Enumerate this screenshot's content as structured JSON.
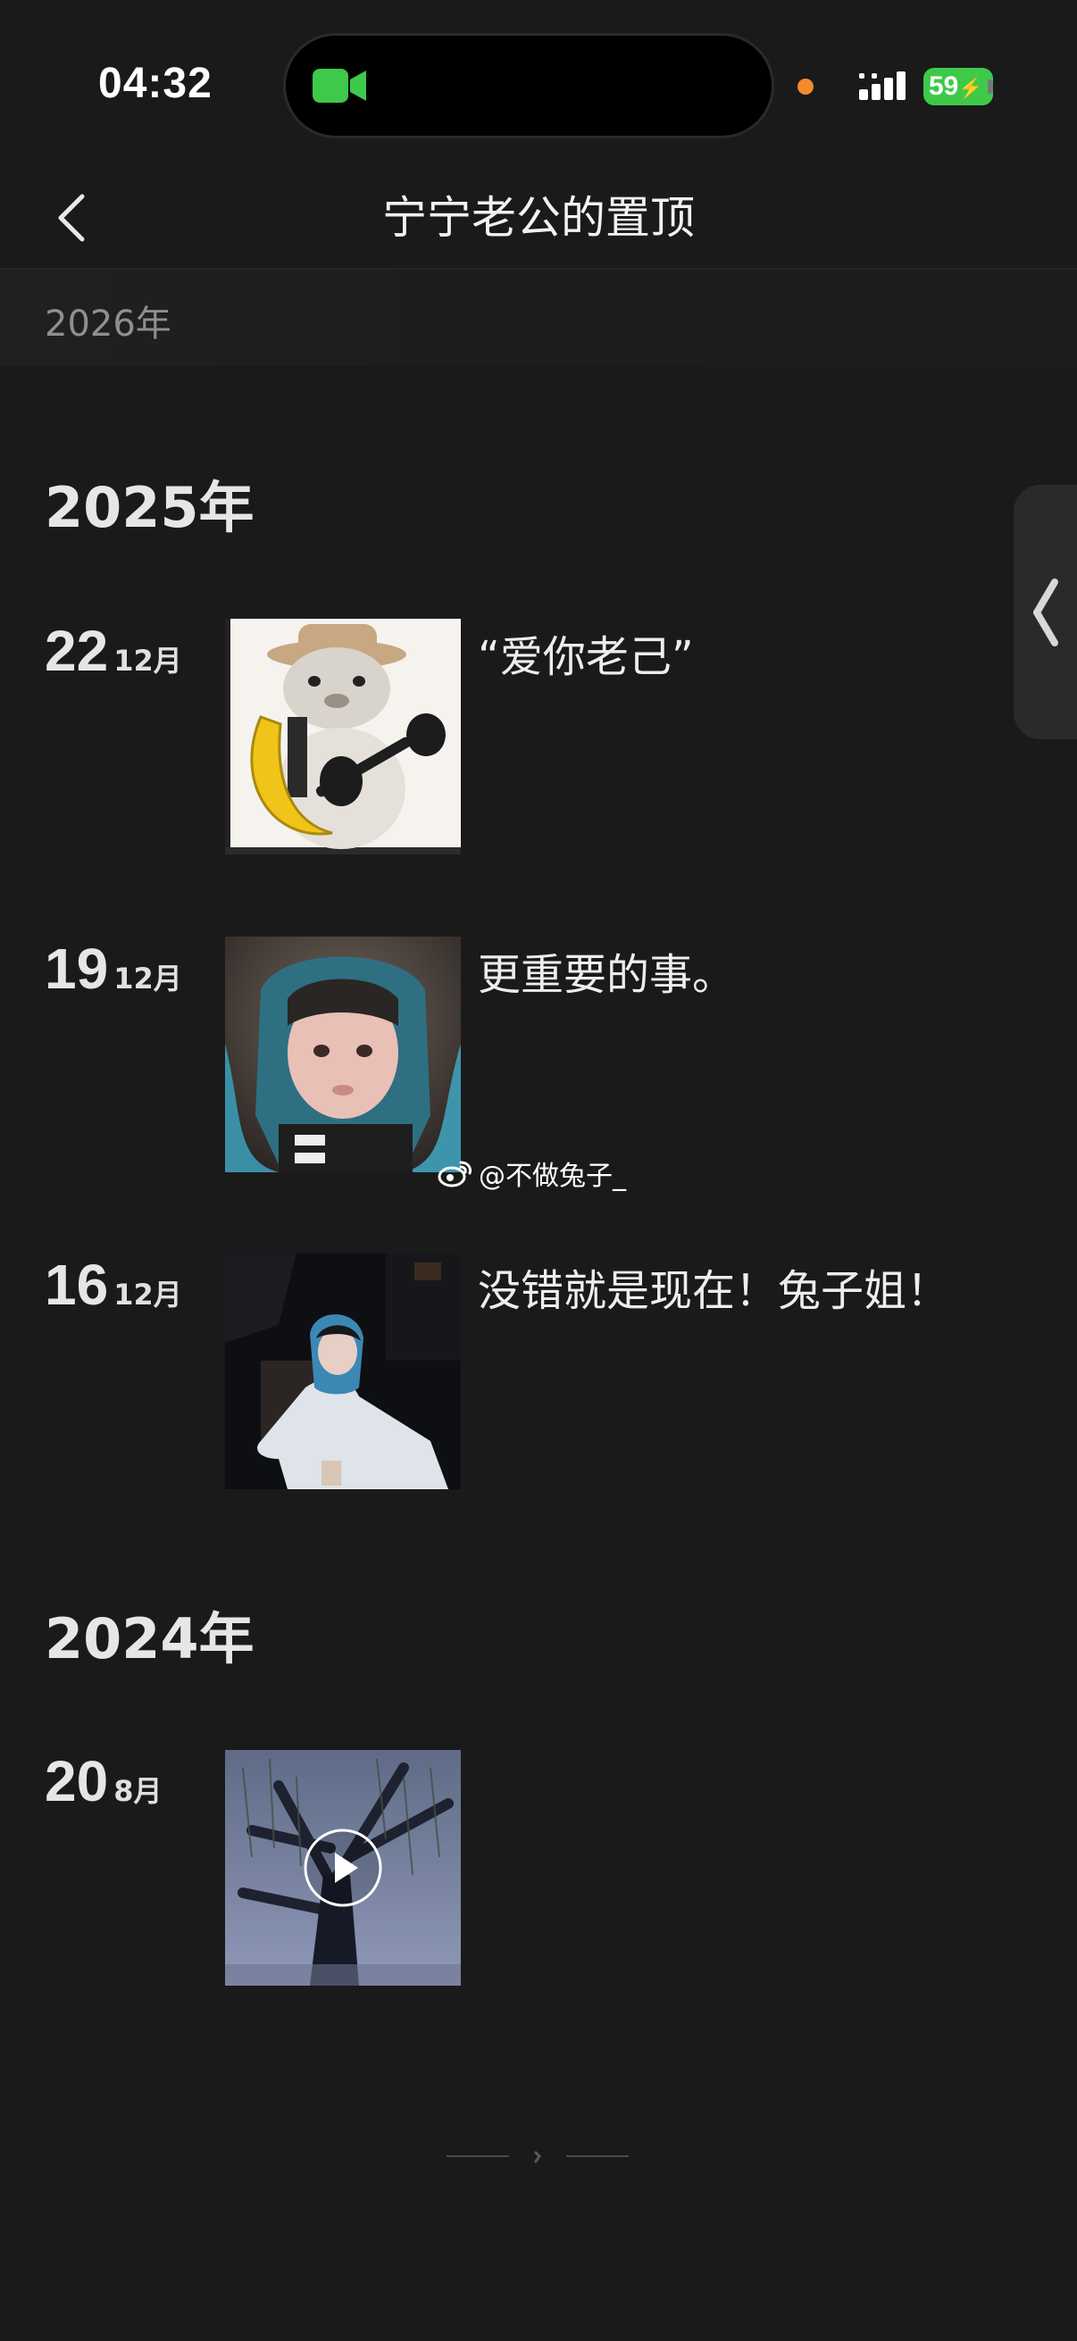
{
  "status_bar": {
    "time": "04:32",
    "battery": "59"
  },
  "nav": {
    "title": "宁宁老公的置顶"
  },
  "sticky_year": "2026年",
  "timeline": [
    {
      "year": "2025年",
      "entries": [
        {
          "day": "22",
          "month": "12月",
          "text": "“爱你老己”",
          "thumb": "cat-with-banana-and-dumbbell"
        },
        {
          "day": "19",
          "month": "12月",
          "text": "更重要的事。",
          "thumb": "girl-blue-hair-hood"
        },
        {
          "day": "16",
          "month": "12月",
          "text": "没错就是现在！兔子姐！",
          "thumb": "girl-blue-hair-night"
        }
      ]
    },
    {
      "year": "2024年",
      "entries": [
        {
          "day": "20",
          "month": "8月",
          "text": "",
          "thumb": "tree-video"
        }
      ]
    }
  ],
  "watermark": "@不做兔子_",
  "colors": {
    "background": "#1a1a1a",
    "battery": "#3ec94a",
    "camera_indicator": "#3ec94a",
    "privacy_dot": "#f58a2b"
  },
  "icons": [
    "back-chevron-icon",
    "video-camera-icon",
    "signal-icon",
    "battery-icon",
    "weibo-icon",
    "play-icon",
    "side-handle-chevron-icon"
  ]
}
